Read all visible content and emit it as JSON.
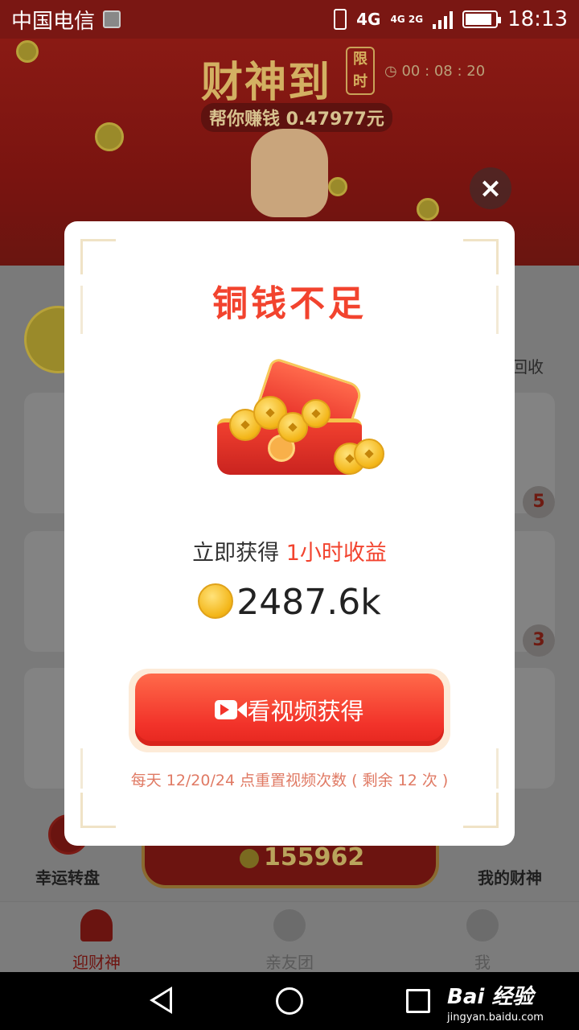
{
  "status_bar": {
    "carrier": "中国电信",
    "network": "4G",
    "network_small": "4G 2G",
    "time": "18:13",
    "battery_level": 0.9
  },
  "background_app": {
    "title": "财神到",
    "limited_badge": "限时",
    "timer": "00 : 08 : 20",
    "earn_text": "帮你赚钱 0.47977元",
    "recycle_label": "回收",
    "badge_counts": [
      "5",
      "3"
    ],
    "wheel_label": "幸运转盘",
    "my_god_label": "我的财神",
    "coin_balance": "155962",
    "tabs": [
      "迎财神",
      "亲友团",
      "我"
    ]
  },
  "modal": {
    "title": "铜钱不足",
    "earn_prefix": "立即获得 ",
    "earn_highlight": "1小时收益",
    "amount": "2487.6k",
    "video_button_label": "看视频获得",
    "reset_note": "每天 12/20/24 点重置视频次数 ( 剩余 12 次 )",
    "close_icon": "×"
  },
  "watermark": {
    "main": "Bai 经验",
    "url": "jingyan.baidu.com"
  },
  "colors": {
    "accent_red": "#f2432e",
    "button_red": "#f2332a",
    "coin_gold": "#f3b517"
  }
}
